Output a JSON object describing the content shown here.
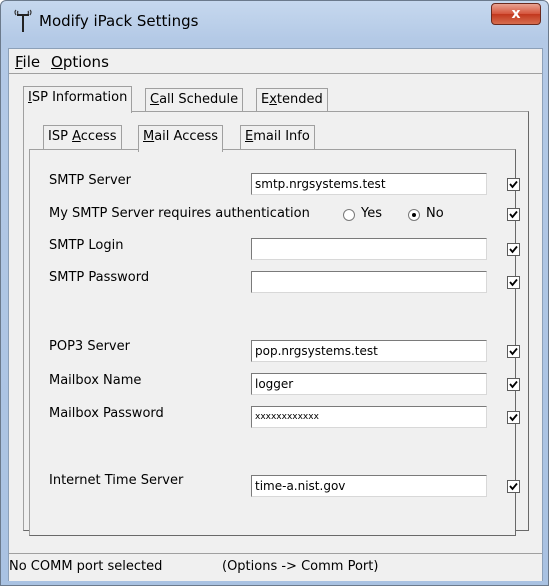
{
  "window": {
    "title": "Modify iPack Settings",
    "close_glyph": "x"
  },
  "menu": {
    "file": {
      "accel": "F",
      "rest": "ile"
    },
    "options": {
      "accel": "O",
      "rest": "ptions"
    }
  },
  "outer_tabs": [
    {
      "pre": "",
      "accel": "I",
      "post": "SP Information",
      "active": true
    },
    {
      "pre": "",
      "accel": "C",
      "post": "all Schedule",
      "active": false
    },
    {
      "pre": "E",
      "accel": "x",
      "post": "tended",
      "active": false
    }
  ],
  "inner_tabs": [
    {
      "pre": "ISP ",
      "accel": "A",
      "post": "ccess",
      "active": false
    },
    {
      "pre": "",
      "accel": "M",
      "post": "ail Access",
      "active": true
    },
    {
      "pre": "",
      "accel": "E",
      "post": "mail Info",
      "active": false
    }
  ],
  "form": {
    "smtp_server": {
      "label": "SMTP Server",
      "value": "smtp.nrgsystems.test",
      "checked": true
    },
    "smtp_auth": {
      "label": "My SMTP Server requires authentication",
      "yes_label": "Yes",
      "no_label": "No",
      "selected": "No",
      "checked": true
    },
    "smtp_login": {
      "label": "SMTP Login",
      "value": "",
      "checked": true
    },
    "smtp_password": {
      "label": "SMTP Password",
      "value": "",
      "checked": true
    },
    "pop3_server": {
      "label": "POP3 Server",
      "value": "pop.nrgsystems.test",
      "checked": true
    },
    "mailbox_name": {
      "label": "Mailbox Name",
      "value": "logger",
      "checked": true
    },
    "mailbox_password": {
      "label": "Mailbox Password",
      "value": "xxxxxxxxxxxx",
      "checked": true
    },
    "time_server": {
      "label": "Internet Time Server",
      "value": "time-a.nist.gov",
      "checked": true
    }
  },
  "status": {
    "left": "No COMM port selected",
    "right": "(Options -> Comm Port)"
  },
  "icons": {
    "app": "antenna-icon",
    "check": "checkmark-icon",
    "close": "close-icon"
  }
}
